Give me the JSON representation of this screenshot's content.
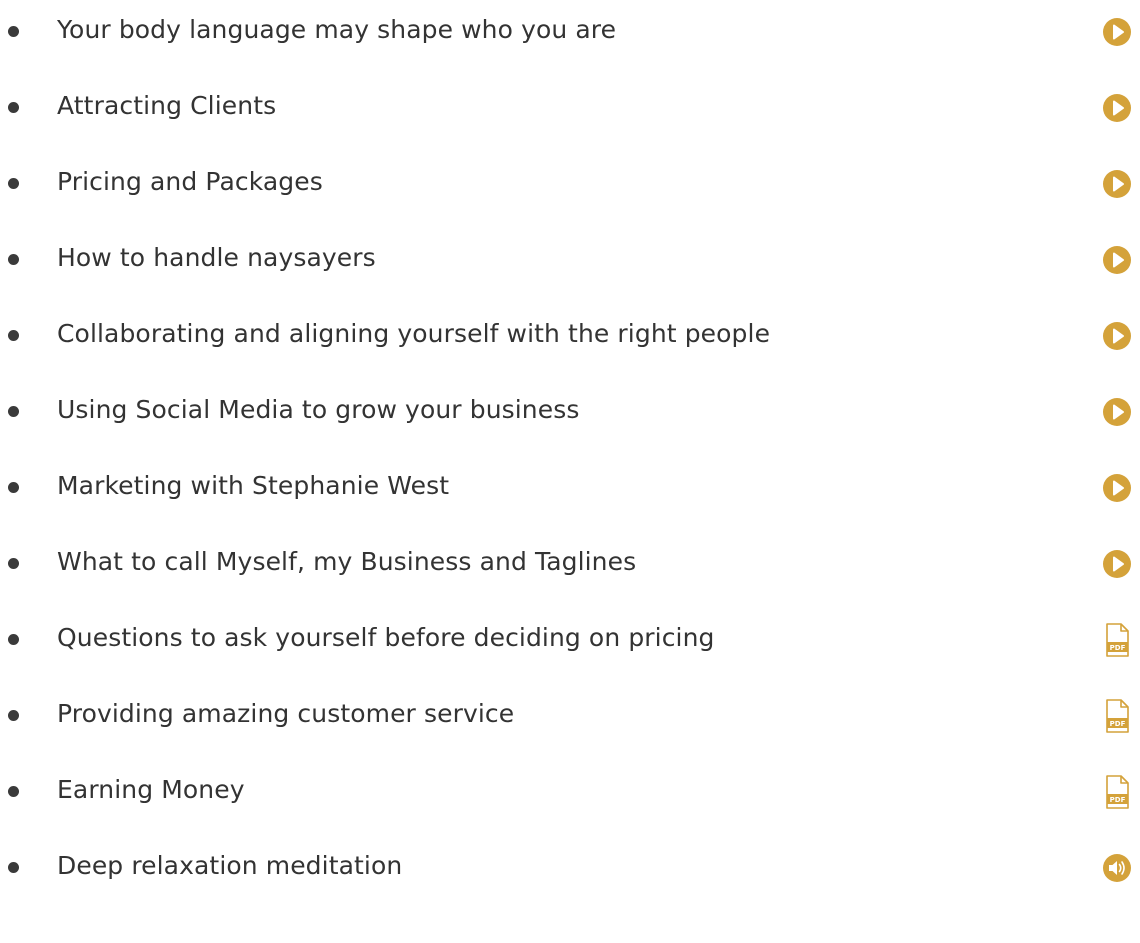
{
  "accent_color": "#d4a23a",
  "items": [
    {
      "label": "Your body language may shape who you are",
      "icon": "play-icon"
    },
    {
      "label": "Attracting Clients",
      "icon": "play-icon"
    },
    {
      "label": "Pricing and Packages",
      "icon": "play-icon"
    },
    {
      "label": "How to handle naysayers",
      "icon": "play-icon"
    },
    {
      "label": "Collaborating and aligning yourself with the right people",
      "icon": "play-icon"
    },
    {
      "label": "Using Social Media to grow your business",
      "icon": "play-icon"
    },
    {
      "label": "Marketing with Stephanie West",
      "icon": "play-icon"
    },
    {
      "label": "What to call Myself, my Business and Taglines",
      "icon": "play-icon"
    },
    {
      "label": "Questions to ask yourself before deciding on pricing",
      "icon": "pdf-icon",
      "icon_text": "PDF"
    },
    {
      "label": "Providing amazing customer service",
      "icon": "pdf-icon",
      "icon_text": "PDF"
    },
    {
      "label": "Earning Money",
      "icon": "pdf-icon",
      "icon_text": "PDF"
    },
    {
      "label": "Deep relaxation meditation",
      "icon": "audio-icon"
    }
  ]
}
